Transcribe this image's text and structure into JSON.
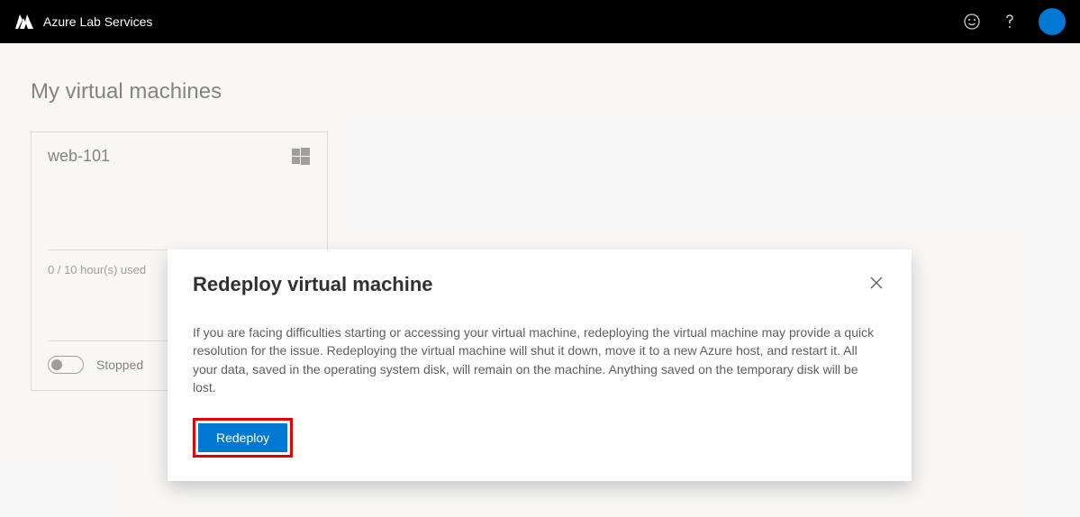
{
  "header": {
    "brand": "Azure Lab Services"
  },
  "page": {
    "title": "My virtual machines"
  },
  "vm": {
    "name": "web-101",
    "usage": "0 / 10 hour(s) used",
    "status": "Stopped"
  },
  "dialog": {
    "title": "Redeploy virtual machine",
    "body": "If you are facing difficulties starting or accessing your virtual machine, redeploying the virtual machine may provide a quick resolution for the issue. Redeploying the virtual machine will shut it down, move it to a new Azure host, and restart it. All your data, saved in the operating system disk, will remain on the machine. Anything saved on the temporary disk will be lost.",
    "button": "Redeploy"
  }
}
